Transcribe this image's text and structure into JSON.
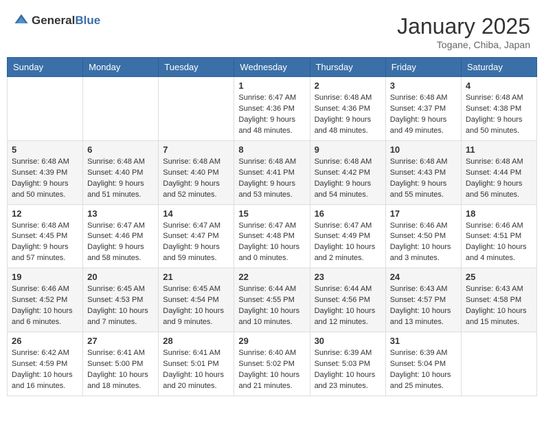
{
  "logo": {
    "general": "General",
    "blue": "Blue"
  },
  "title": "January 2025",
  "location": "Togane, Chiba, Japan",
  "weekdays": [
    "Sunday",
    "Monday",
    "Tuesday",
    "Wednesday",
    "Thursday",
    "Friday",
    "Saturday"
  ],
  "weeks": [
    [
      {
        "day": "",
        "content": ""
      },
      {
        "day": "",
        "content": ""
      },
      {
        "day": "",
        "content": ""
      },
      {
        "day": "1",
        "content": "Sunrise: 6:47 AM\nSunset: 4:36 PM\nDaylight: 9 hours and 48 minutes."
      },
      {
        "day": "2",
        "content": "Sunrise: 6:48 AM\nSunset: 4:36 PM\nDaylight: 9 hours and 48 minutes."
      },
      {
        "day": "3",
        "content": "Sunrise: 6:48 AM\nSunset: 4:37 PM\nDaylight: 9 hours and 49 minutes."
      },
      {
        "day": "4",
        "content": "Sunrise: 6:48 AM\nSunset: 4:38 PM\nDaylight: 9 hours and 50 minutes."
      }
    ],
    [
      {
        "day": "5",
        "content": "Sunrise: 6:48 AM\nSunset: 4:39 PM\nDaylight: 9 hours and 50 minutes."
      },
      {
        "day": "6",
        "content": "Sunrise: 6:48 AM\nSunset: 4:40 PM\nDaylight: 9 hours and 51 minutes."
      },
      {
        "day": "7",
        "content": "Sunrise: 6:48 AM\nSunset: 4:40 PM\nDaylight: 9 hours and 52 minutes."
      },
      {
        "day": "8",
        "content": "Sunrise: 6:48 AM\nSunset: 4:41 PM\nDaylight: 9 hours and 53 minutes."
      },
      {
        "day": "9",
        "content": "Sunrise: 6:48 AM\nSunset: 4:42 PM\nDaylight: 9 hours and 54 minutes."
      },
      {
        "day": "10",
        "content": "Sunrise: 6:48 AM\nSunset: 4:43 PM\nDaylight: 9 hours and 55 minutes."
      },
      {
        "day": "11",
        "content": "Sunrise: 6:48 AM\nSunset: 4:44 PM\nDaylight: 9 hours and 56 minutes."
      }
    ],
    [
      {
        "day": "12",
        "content": "Sunrise: 6:48 AM\nSunset: 4:45 PM\nDaylight: 9 hours and 57 minutes."
      },
      {
        "day": "13",
        "content": "Sunrise: 6:47 AM\nSunset: 4:46 PM\nDaylight: 9 hours and 58 minutes."
      },
      {
        "day": "14",
        "content": "Sunrise: 6:47 AM\nSunset: 4:47 PM\nDaylight: 9 hours and 59 minutes."
      },
      {
        "day": "15",
        "content": "Sunrise: 6:47 AM\nSunset: 4:48 PM\nDaylight: 10 hours and 0 minutes."
      },
      {
        "day": "16",
        "content": "Sunrise: 6:47 AM\nSunset: 4:49 PM\nDaylight: 10 hours and 2 minutes."
      },
      {
        "day": "17",
        "content": "Sunrise: 6:46 AM\nSunset: 4:50 PM\nDaylight: 10 hours and 3 minutes."
      },
      {
        "day": "18",
        "content": "Sunrise: 6:46 AM\nSunset: 4:51 PM\nDaylight: 10 hours and 4 minutes."
      }
    ],
    [
      {
        "day": "19",
        "content": "Sunrise: 6:46 AM\nSunset: 4:52 PM\nDaylight: 10 hours and 6 minutes."
      },
      {
        "day": "20",
        "content": "Sunrise: 6:45 AM\nSunset: 4:53 PM\nDaylight: 10 hours and 7 minutes."
      },
      {
        "day": "21",
        "content": "Sunrise: 6:45 AM\nSunset: 4:54 PM\nDaylight: 10 hours and 9 minutes."
      },
      {
        "day": "22",
        "content": "Sunrise: 6:44 AM\nSunset: 4:55 PM\nDaylight: 10 hours and 10 minutes."
      },
      {
        "day": "23",
        "content": "Sunrise: 6:44 AM\nSunset: 4:56 PM\nDaylight: 10 hours and 12 minutes."
      },
      {
        "day": "24",
        "content": "Sunrise: 6:43 AM\nSunset: 4:57 PM\nDaylight: 10 hours and 13 minutes."
      },
      {
        "day": "25",
        "content": "Sunrise: 6:43 AM\nSunset: 4:58 PM\nDaylight: 10 hours and 15 minutes."
      }
    ],
    [
      {
        "day": "26",
        "content": "Sunrise: 6:42 AM\nSunset: 4:59 PM\nDaylight: 10 hours and 16 minutes."
      },
      {
        "day": "27",
        "content": "Sunrise: 6:41 AM\nSunset: 5:00 PM\nDaylight: 10 hours and 18 minutes."
      },
      {
        "day": "28",
        "content": "Sunrise: 6:41 AM\nSunset: 5:01 PM\nDaylight: 10 hours and 20 minutes."
      },
      {
        "day": "29",
        "content": "Sunrise: 6:40 AM\nSunset: 5:02 PM\nDaylight: 10 hours and 21 minutes."
      },
      {
        "day": "30",
        "content": "Sunrise: 6:39 AM\nSunset: 5:03 PM\nDaylight: 10 hours and 23 minutes."
      },
      {
        "day": "31",
        "content": "Sunrise: 6:39 AM\nSunset: 5:04 PM\nDaylight: 10 hours and 25 minutes."
      },
      {
        "day": "",
        "content": ""
      }
    ]
  ]
}
